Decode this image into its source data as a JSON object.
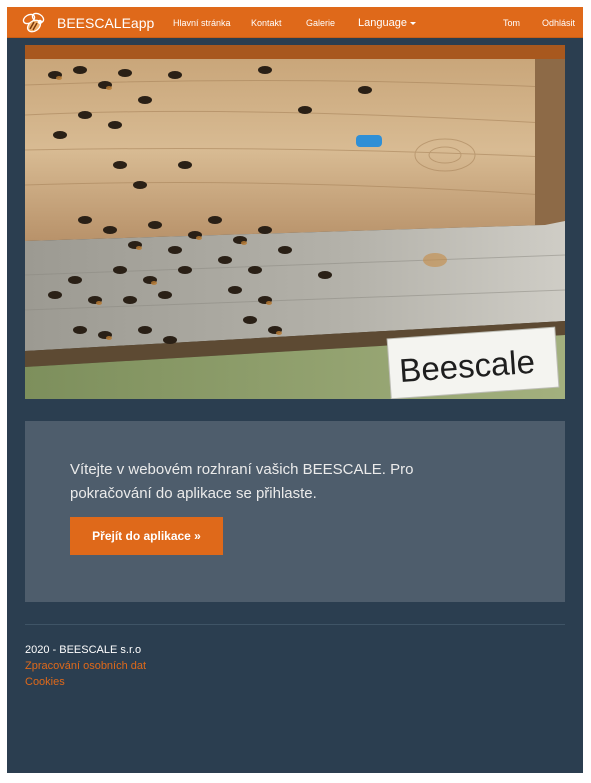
{
  "navbar": {
    "brand": "BEESCALEapp",
    "brand_icon": "bee-icon",
    "links": {
      "home": "Hlavní stránka",
      "contact": "Kontakt",
      "gallery": "Galerie",
      "language": "Language",
      "user": "Tom",
      "logout": "Odhlásit"
    },
    "accent_color": "#df691a"
  },
  "hero": {
    "sign_text": "Beescale"
  },
  "jumbotron": {
    "text": "Vítejte v webovém rozhraní vašich BEESCALE. Pro pokračování do aplikace se přihlaste.",
    "button_label": "Přejít do aplikace »"
  },
  "footer": {
    "copyright": "2020 - BEESCALE s.r.o",
    "privacy_link": "Zpracování osobních dat",
    "cookies_link": "Cookies"
  },
  "colors": {
    "background": "#2b3e50",
    "panel": "#4e5d6c",
    "accent": "#df691a"
  }
}
